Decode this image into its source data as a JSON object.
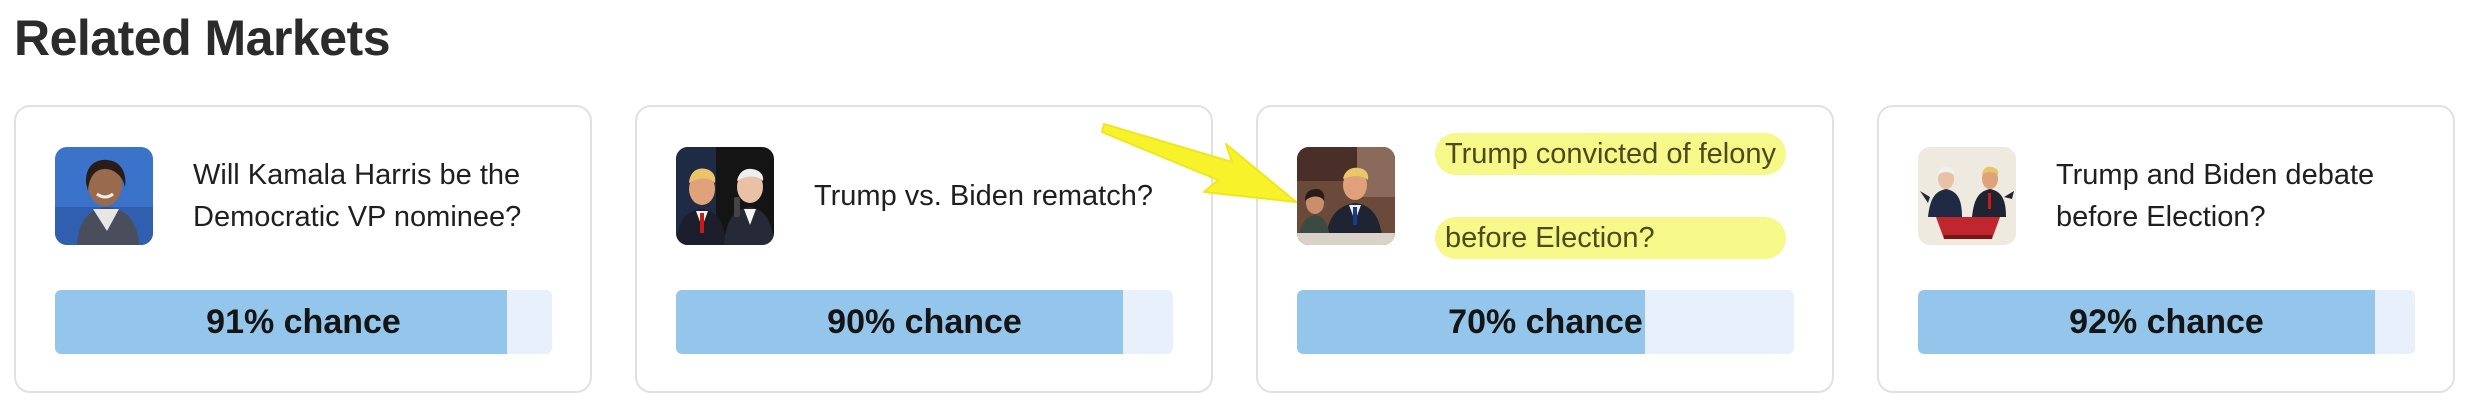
{
  "section": {
    "title": "Related Markets"
  },
  "markets": [
    {
      "question": "Will Kamala Harris be the Democratic VP nominee?",
      "chance_label": "91% chance",
      "chance_pct": 91,
      "thumbnail_icon": "kamala-harris-photo"
    },
    {
      "question": "Trump vs. Biden rematch?",
      "chance_label": "90% chance",
      "chance_pct": 90,
      "thumbnail_icon": "trump-biden-photo"
    },
    {
      "question_line1": "Trump convicted of felony",
      "question_line2": "before Election?",
      "chance_label": "70% chance",
      "chance_pct": 70,
      "highlighted": true,
      "thumbnail_icon": "courtroom-photo"
    },
    {
      "question": "Trump and Biden debate before Election?",
      "chance_label": "92% chance",
      "chance_pct": 92,
      "thumbnail_icon": "debate-illustration"
    }
  ],
  "annotation": {
    "arrow_color": "#f7f22a",
    "highlight_color": "#f6f88a"
  },
  "colors": {
    "bar_fill": "#94c6ec",
    "bar_track": "#e8f0fb",
    "card_border": "#e1e1e1"
  }
}
